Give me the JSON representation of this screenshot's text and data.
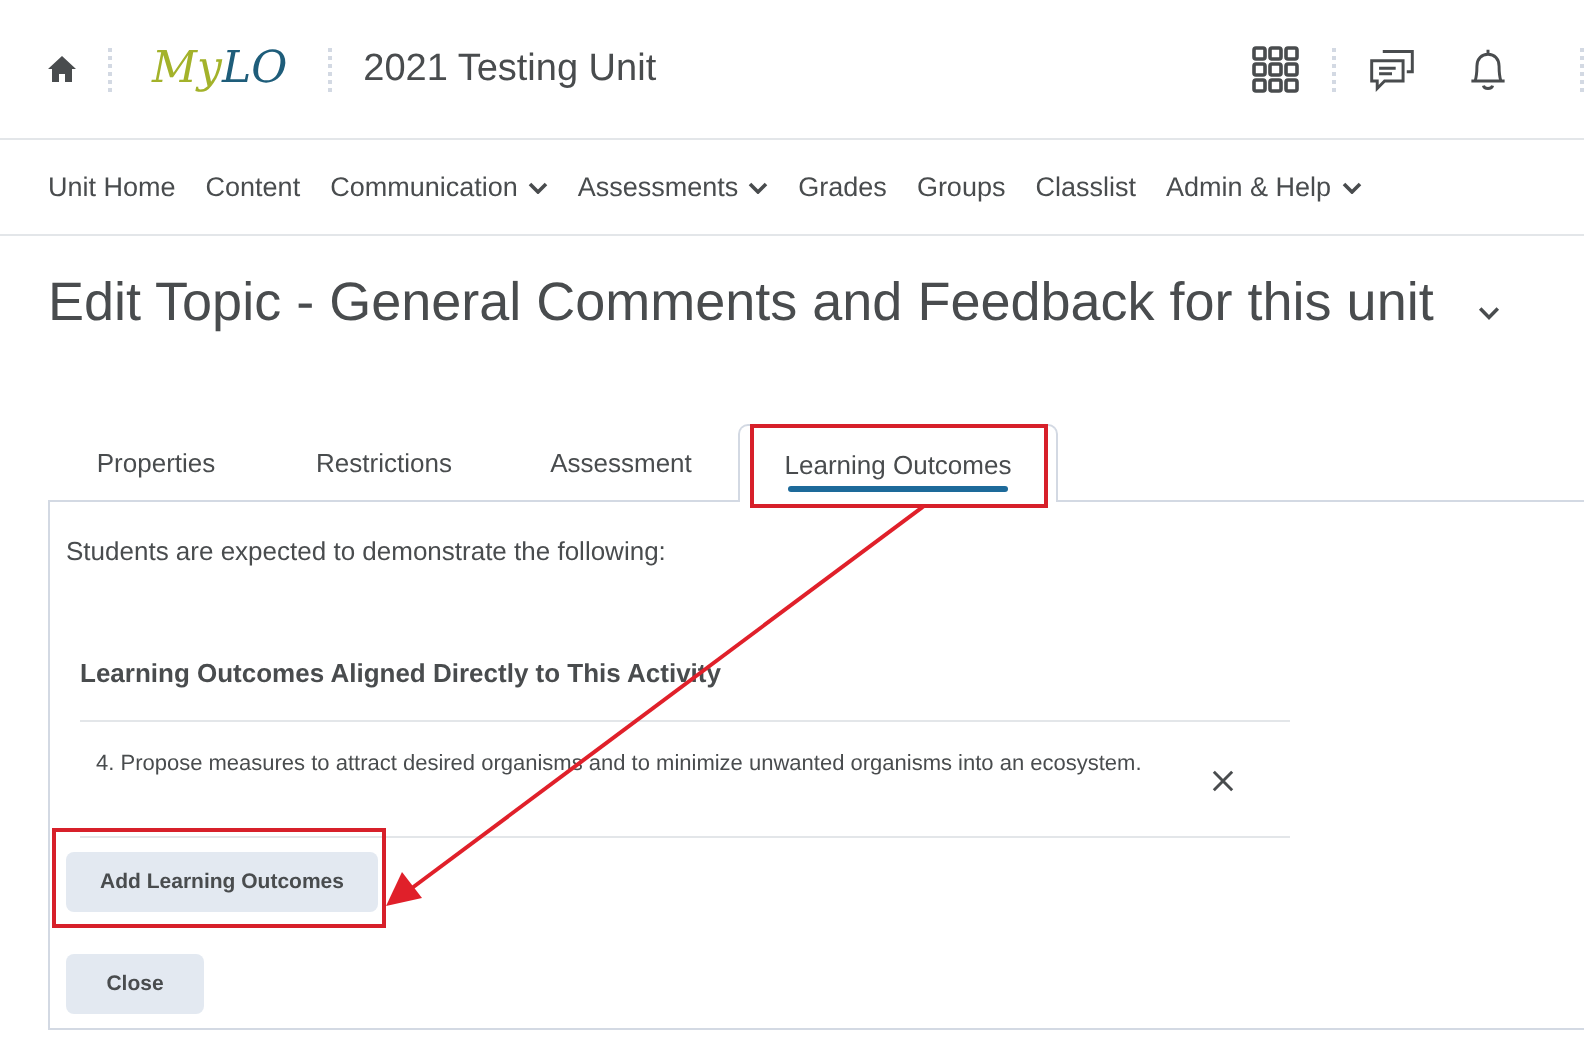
{
  "header": {
    "logo": [
      "My",
      "LO"
    ],
    "unit_title": "2021 Testing Unit"
  },
  "nav": [
    {
      "label": "Unit Home",
      "dropdown": false
    },
    {
      "label": "Content",
      "dropdown": false
    },
    {
      "label": "Communication",
      "dropdown": true
    },
    {
      "label": "Assessments",
      "dropdown": true
    },
    {
      "label": "Grades",
      "dropdown": false
    },
    {
      "label": "Groups",
      "dropdown": false
    },
    {
      "label": "Classlist",
      "dropdown": false
    },
    {
      "label": "Admin & Help",
      "dropdown": true
    }
  ],
  "page_title": "Edit Topic - General Comments and Feedback for this unit",
  "tabs": [
    {
      "label": "Properties",
      "selected": false
    },
    {
      "label": "Restrictions",
      "selected": false
    },
    {
      "label": "Assessment",
      "selected": false
    },
    {
      "label": "Learning Outcomes",
      "selected": true
    }
  ],
  "panel": {
    "intro": "Students are expected to demonstrate the following:",
    "heading": "Learning Outcomes Aligned Directly to This Activity",
    "outcomes": [
      "4. Propose measures to attract desired organisms and to minimize unwanted organisms into an ecosystem."
    ],
    "buttons": [
      "Add Learning Outcomes",
      "Close"
    ]
  }
}
